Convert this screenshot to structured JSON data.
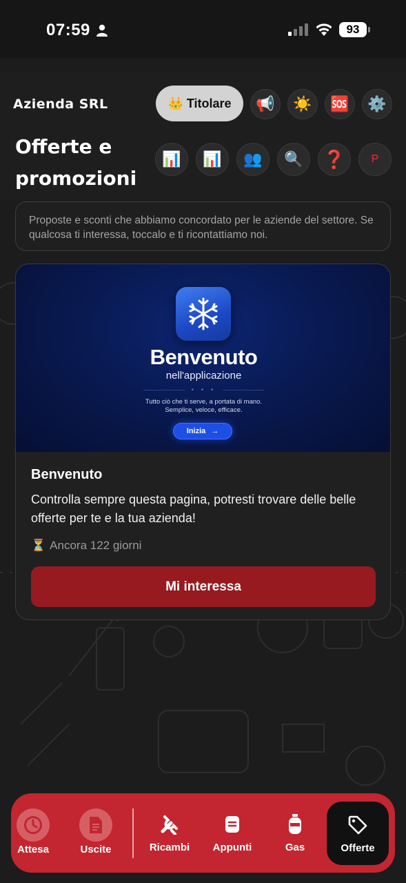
{
  "status_bar": {
    "time": "07:59",
    "battery": "93"
  },
  "header": {
    "company": "Azienda SRL",
    "role_icon": "👑",
    "role_label": "Titolare",
    "title": "Offerte e promozioni",
    "icons": {
      "megaphone": "📢",
      "sun": "☀️",
      "sos": "🆘",
      "gear": "⚙️",
      "chart1": "📊",
      "chart2": "📊",
      "users": "👥",
      "search": "🔍",
      "help": "❓",
      "profile": "P"
    }
  },
  "description": "Proposte e sconti che abbiamo concordato per le aziende del settore. Se qualcosa ti interessa, toccalo e ti ricontattiamo noi.",
  "offer": {
    "banner": {
      "title": "Benvenuto",
      "subtitle": "nell'applicazione",
      "dots": "• • •",
      "tagline1": "Tutto ciò che ti serve, a portata di mano.",
      "tagline2": "Semplice, veloce, efficace.",
      "button": "Inizia",
      "button_arrow": "→"
    },
    "title": "Benvenuto",
    "text": "Controlla sempre questa pagina, potresti trovare delle belle offerte per te e la tua azienda!",
    "remaining_icon": "⏳",
    "remaining": "Ancora 122 giorni",
    "cta": "Mi interessa"
  },
  "nav": {
    "items": [
      {
        "label": "Attesa",
        "icon": "clock-icon"
      },
      {
        "label": "Uscite",
        "icon": "document-icon"
      },
      {
        "label": "Ricambi",
        "icon": "tools-icon"
      },
      {
        "label": "Appunti",
        "icon": "notes-icon"
      },
      {
        "label": "Gas",
        "icon": "gas-cylinder-icon"
      },
      {
        "label": "Offerte",
        "icon": "tag-icon",
        "active": true
      }
    ]
  },
  "colors": {
    "accent_red": "#c32630",
    "cta_red": "#961a20",
    "background": "#1c1c1d"
  }
}
